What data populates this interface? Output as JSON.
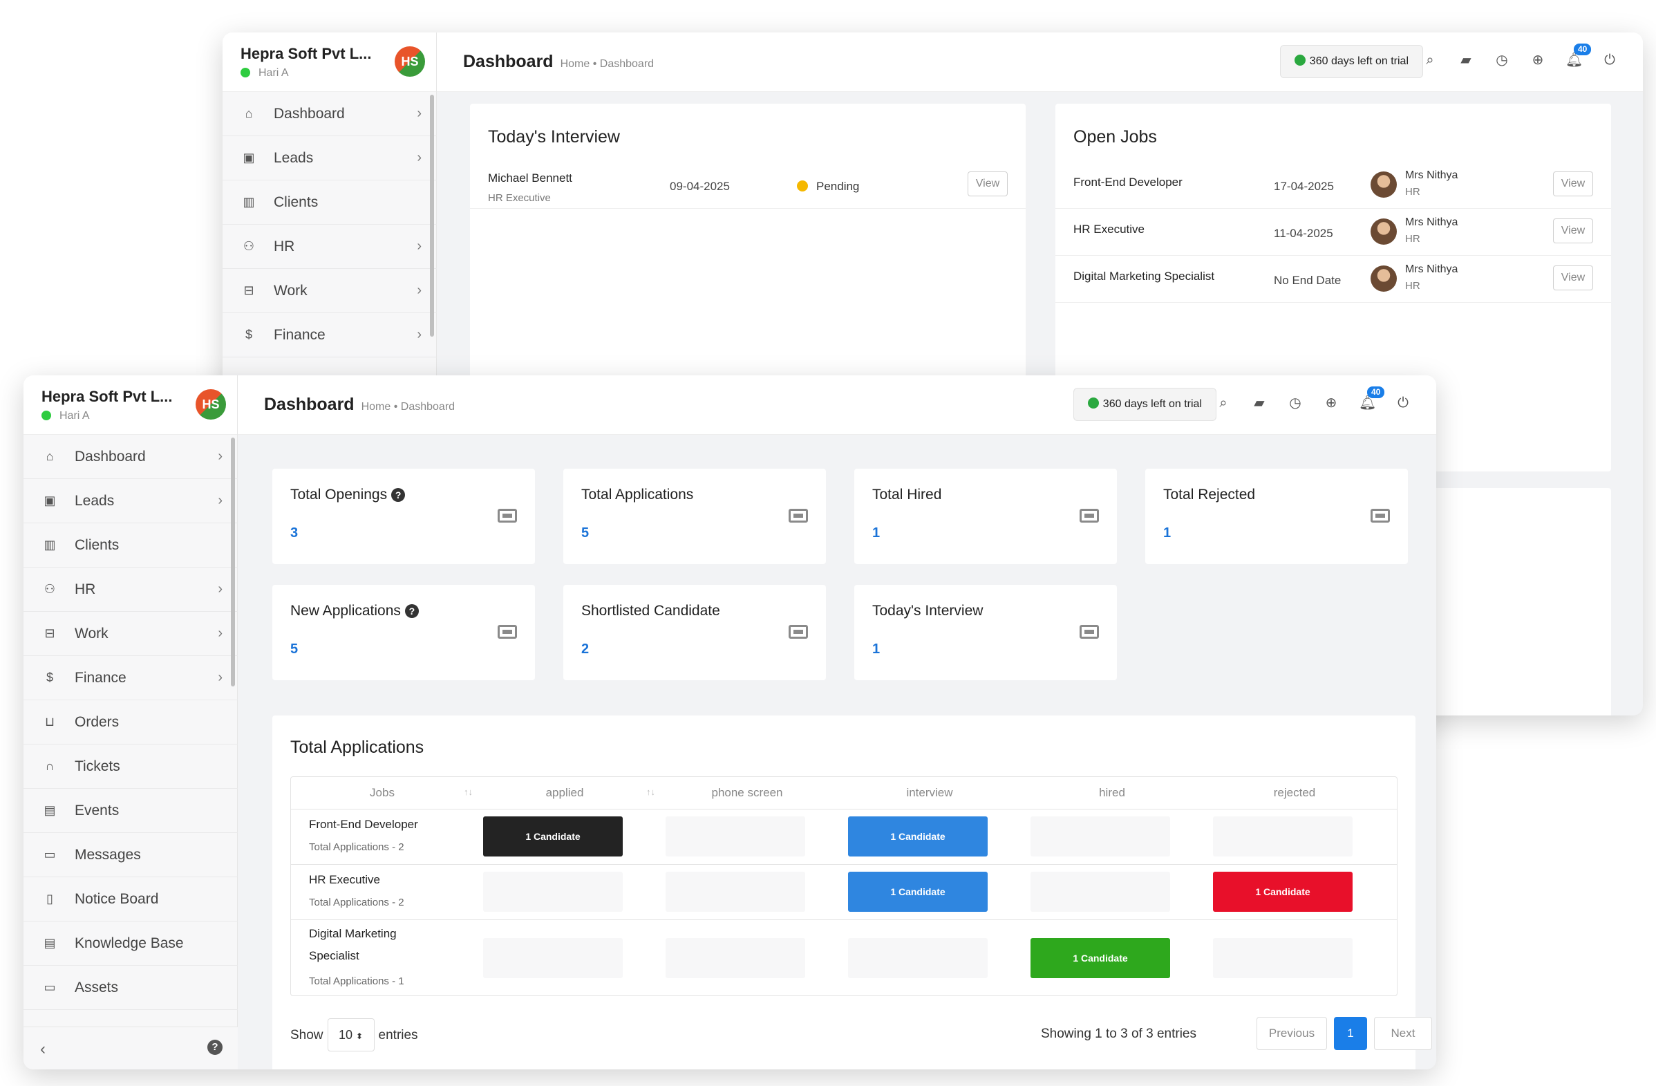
{
  "app": {
    "company": "Hepra Soft Pvt L...",
    "user": "Hari A",
    "logo_text": "HS",
    "page_title": "Dashboard",
    "breadcrumb": "Home • Dashboard",
    "trial_text": "360 days left on trial",
    "notification_count": "40"
  },
  "topbar_icons": [
    "search-icon",
    "sticky-note-icon",
    "clock-icon",
    "add-circle-icon",
    "bell-icon",
    "power-icon"
  ],
  "sidebar": {
    "items": [
      {
        "label": "Dashboard",
        "icon": "home-icon",
        "has_chevron": true
      },
      {
        "label": "Leads",
        "icon": "id-card-icon",
        "has_chevron": true
      },
      {
        "label": "Clients",
        "icon": "building-icon",
        "has_chevron": false
      },
      {
        "label": "HR",
        "icon": "users-icon",
        "has_chevron": true
      },
      {
        "label": "Work",
        "icon": "briefcase-icon",
        "has_chevron": true
      },
      {
        "label": "Finance",
        "icon": "dollar-icon",
        "has_chevron": true
      },
      {
        "label": "Orders",
        "icon": "cart-icon",
        "has_chevron": false
      },
      {
        "label": "Tickets",
        "icon": "headset-icon",
        "has_chevron": false
      },
      {
        "label": "Events",
        "icon": "calendar-icon",
        "has_chevron": false
      },
      {
        "label": "Messages",
        "icon": "chat-icon",
        "has_chevron": false
      },
      {
        "label": "Notice Board",
        "icon": "clipboard-icon",
        "has_chevron": false
      },
      {
        "label": "Knowledge Base",
        "icon": "document-icon",
        "has_chevron": false
      },
      {
        "label": "Assets",
        "icon": "monitor-icon",
        "has_chevron": false
      }
    ]
  },
  "todays_interview": {
    "title": "Today's Interview",
    "rows": [
      {
        "name": "Michael Bennett",
        "role": "HR Executive",
        "date": "09-04-2025",
        "status": "Pending",
        "action": "View"
      }
    ]
  },
  "open_jobs": {
    "title": "Open Jobs",
    "rows": [
      {
        "job": "Front-End Developer",
        "date": "17-04-2025",
        "person": "Mrs Nithya",
        "dept": "HR",
        "action": "View"
      },
      {
        "job": "HR Executive",
        "date": "11-04-2025",
        "person": "Mrs Nithya",
        "dept": "HR",
        "action": "View"
      },
      {
        "job": "Digital Marketing Specialist",
        "date": "No End Date",
        "person": "Mrs Nithya",
        "dept": "HR",
        "action": "View"
      }
    ]
  },
  "stats": [
    {
      "title": "Total Openings",
      "value": "3",
      "help": true
    },
    {
      "title": "Total Applications",
      "value": "5",
      "help": false
    },
    {
      "title": "Total Hired",
      "value": "1",
      "help": false
    },
    {
      "title": "Total Rejected",
      "value": "1",
      "help": false
    },
    {
      "title": "New Applications",
      "value": "5",
      "help": true
    },
    {
      "title": "Shortlisted Candidate",
      "value": "2",
      "help": false
    },
    {
      "title": "Today's Interview",
      "value": "1",
      "help": false
    }
  ],
  "applications": {
    "title": "Total Applications",
    "columns": [
      "Jobs",
      "applied",
      "phone screen",
      "interview",
      "hired",
      "rejected"
    ],
    "rows": [
      {
        "job": "Front-End Developer",
        "total": "Total Applications - 2",
        "cells": [
          "1 Candidate",
          "",
          "1 Candidate",
          "",
          ""
        ]
      },
      {
        "job": "HR Executive",
        "total": "Total Applications - 2",
        "cells": [
          "",
          "",
          "1 Candidate",
          "",
          "1 Candidate"
        ]
      },
      {
        "job": "Digital Marketing Specialist",
        "total": "Total Applications - 1",
        "cells": [
          "",
          "",
          "",
          "1 Candidate",
          ""
        ]
      }
    ],
    "show_label": "Show",
    "page_size": "10",
    "entries_label": "entries",
    "info": "Showing 1 to 3 of 3 entries",
    "prev": "Previous",
    "page": "1",
    "next": "Next"
  },
  "colors": {
    "accent": "#1a7ee8",
    "applied": "#232323",
    "interview": "#2f86e0",
    "hired": "#2ea81d",
    "rejected": "#e8102a",
    "pending": "#f5b800",
    "online": "#2ecc40"
  }
}
